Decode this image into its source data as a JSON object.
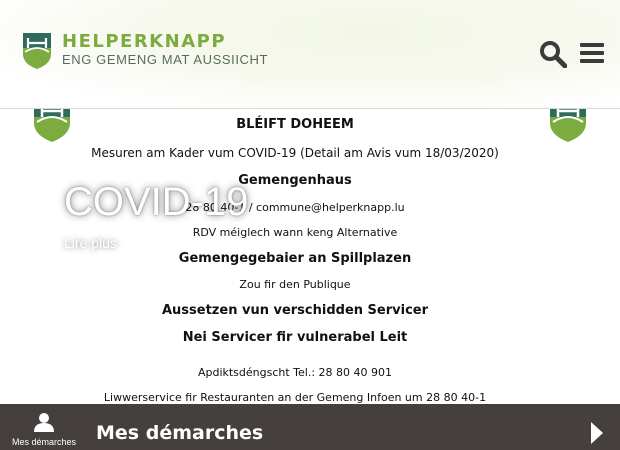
{
  "header": {
    "brand_name": "HELPERKNAPP",
    "brand_tagline": "ENG GEMENG MAT AUSSIICHT",
    "brand_color": "#7cab40",
    "icons": [
      "logo-shield-icon",
      "search-icon",
      "hamburger-menu-icon"
    ]
  },
  "notice": {
    "lines": [
      "BLÉIFT DOHEEM",
      "Mesuren am Kader vum COVID-19 (Detail am Avis vum 18/03/2020)",
      "Gemengenhaus",
      "28 80 40-1 / commune@helperknapp.lu",
      "RDV méiglech wann keng Alternative",
      "Gemengegebaier an Spillplazen",
      "Zou fir den Publique",
      "Aussetzen vun verschidden Servicer",
      "Nei Servicer fir vulnerabel Leit",
      "Apdiktsdéngscht Tel.: 28 80 40 901",
      "Liwwerservice fir Restauranten an der Gemeng Infoen um 28 80 40-1"
    ]
  },
  "slide": {
    "title": "COVID-19",
    "link": "Lire plus"
  },
  "bottom_bar": {
    "icon_label": "Mes démarches",
    "title": "Mes démarches",
    "background_color": "#453f3d",
    "icons": [
      "user-icon",
      "arrow-right-icon"
    ]
  }
}
